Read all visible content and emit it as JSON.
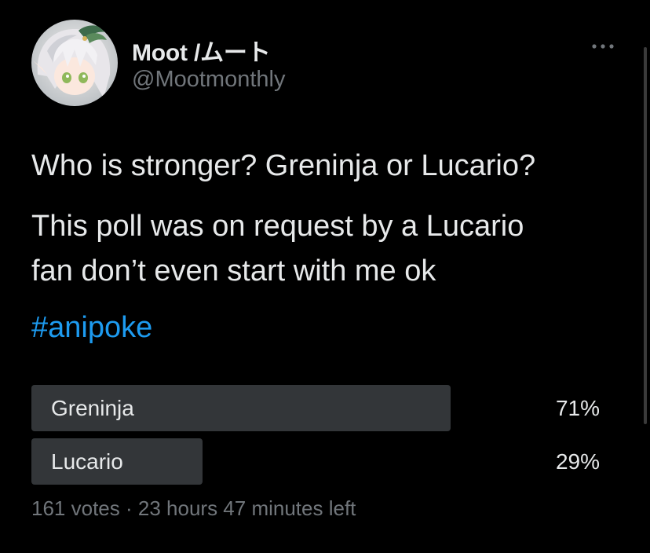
{
  "user": {
    "display_name": "Moot /ムート",
    "handle": "@Mootmonthly",
    "avatar": "anime-character-avatar"
  },
  "menu": {
    "icon": "more-horizontal-icon"
  },
  "tweet": {
    "line1": "Who is stronger? Greninja or Lucario?",
    "line2a": "This poll was on request by a Lucario",
    "line2b": "fan don’t even start with me ok",
    "hashtag": "#anipoke"
  },
  "poll": {
    "options": [
      {
        "label": "Greninja",
        "percent_text": "71%",
        "percent": 71
      },
      {
        "label": "Lucario",
        "percent_text": "29%",
        "percent": 29
      }
    ],
    "votes": "161 votes",
    "separator": "·",
    "time_left": "23 hours 47 minutes left"
  },
  "colors": {
    "background": "#000000",
    "text": "#e7e9ea",
    "muted": "#71767b",
    "link": "#1d9bf0",
    "poll_bar": "#333639"
  }
}
